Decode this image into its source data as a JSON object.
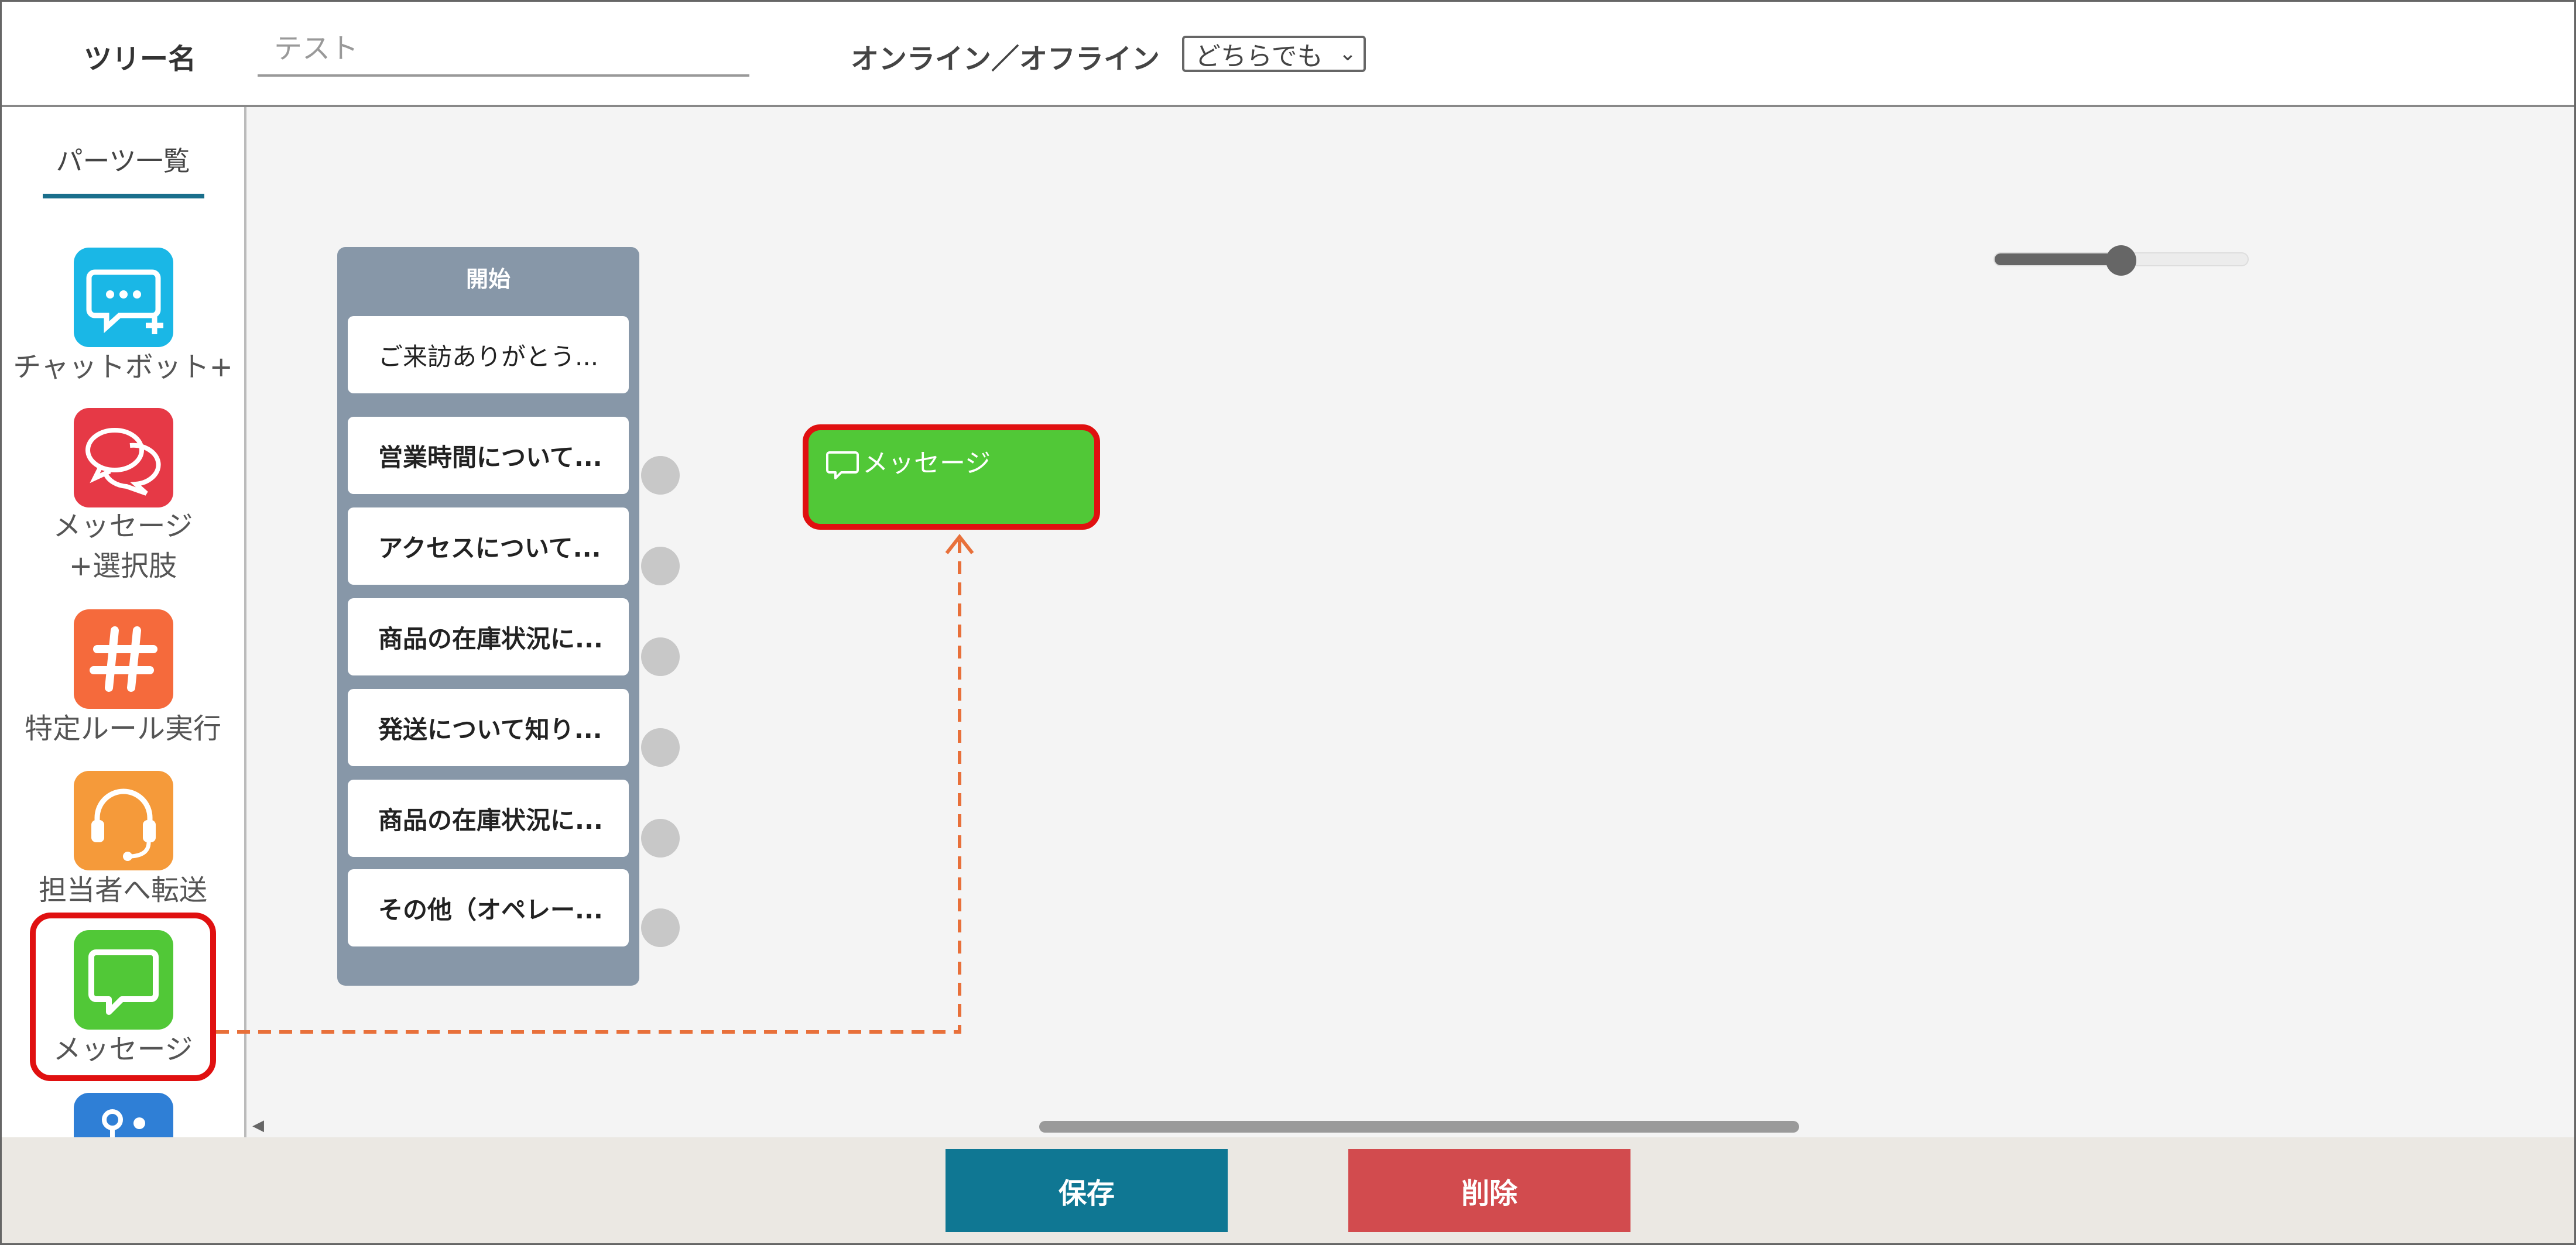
{
  "header": {
    "tree_name_label": "ツリー名",
    "tree_name_placeholder": "テスト",
    "online_label": "オンライン／オフライン",
    "online_select_value": "どちらでも"
  },
  "sidebar": {
    "title": "パーツ一覧",
    "items": [
      {
        "label": "チャットボット+",
        "icon": "chatbot-plus-icon",
        "color": "#1ab7e6"
      },
      {
        "label": "メッセージ",
        "label2": "+選択肢",
        "icon": "message-choice-icon",
        "color": "#e63946"
      },
      {
        "label": "特定ルール実行",
        "icon": "hashtag-icon",
        "color": "#f56a3c"
      },
      {
        "label": "担当者へ転送",
        "icon": "headset-icon",
        "color": "#f59a3a"
      },
      {
        "label": "メッセージ",
        "icon": "message-icon",
        "color": "#51c837"
      },
      {
        "label": "",
        "icon": "branch-icon",
        "color": "#2f7fd6"
      }
    ]
  },
  "canvas": {
    "start_block": {
      "title": "開始",
      "nodes": [
        "ご来訪ありがとう...",
        "営業時間について...",
        "アクセスについて...",
        "商品の在庫状況に...",
        "発送について知り...",
        "商品の在庫状況に...",
        "その他（オペレー..."
      ]
    },
    "message_node": {
      "label": "メッセージ"
    },
    "zoom_level": 0.5
  },
  "footer": {
    "save_label": "保存",
    "delete_label": "削除"
  },
  "colors": {
    "highlight": "#e01010",
    "dashed_arrow": "#e8703a",
    "save": "#0f7793",
    "delete": "#d24b4e"
  }
}
